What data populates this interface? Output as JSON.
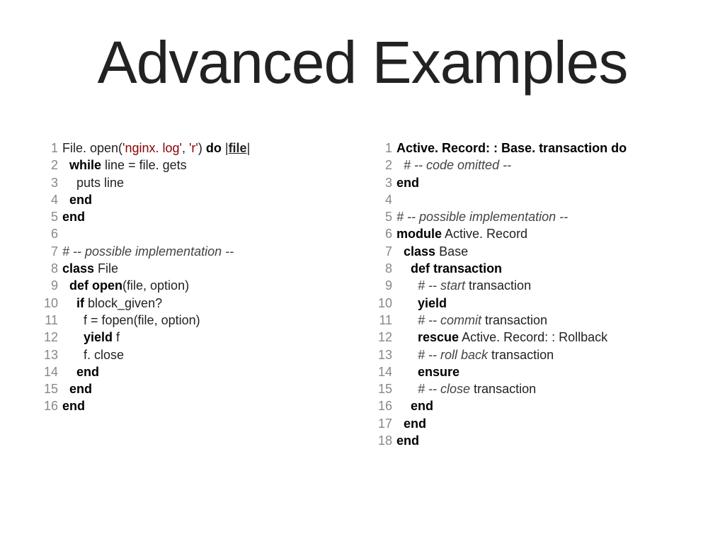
{
  "title": "Advanced Examples",
  "left": [
    {
      "n": "1",
      "segs": [
        {
          "t": "File. open("
        },
        {
          "t": "'nginx. log'",
          "c": "tok-str"
        },
        {
          "t": ", "
        },
        {
          "t": "'r'",
          "c": "tok-str"
        },
        {
          "t": ") "
        },
        {
          "t": "do",
          "c": "tok-kw"
        },
        {
          "t": " |"
        },
        {
          "t": "file",
          "c": "tok-br"
        },
        {
          "t": "|"
        }
      ]
    },
    {
      "n": "2",
      "segs": [
        {
          "t": "  "
        },
        {
          "t": "while",
          "c": "tok-kw"
        },
        {
          "t": " line = file. gets"
        }
      ]
    },
    {
      "n": "3",
      "segs": [
        {
          "t": "    puts line"
        }
      ]
    },
    {
      "n": "4",
      "segs": [
        {
          "t": "  "
        },
        {
          "t": "end",
          "c": "tok-kw"
        }
      ]
    },
    {
      "n": "5",
      "segs": [
        {
          "t": "end",
          "c": "tok-kw"
        }
      ]
    },
    {
      "n": "6",
      "segs": [
        {
          "t": ""
        }
      ]
    },
    {
      "n": "7",
      "segs": [
        {
          "t": "# -- possible implementation --",
          "c": "tok-com"
        }
      ]
    },
    {
      "n": "8",
      "segs": [
        {
          "t": "class",
          "c": "tok-kw"
        },
        {
          "t": " File"
        }
      ]
    },
    {
      "n": "9",
      "segs": [
        {
          "t": "  "
        },
        {
          "t": "def",
          "c": "tok-kw"
        },
        {
          "t": " "
        },
        {
          "t": "open",
          "c": "tok-kw"
        },
        {
          "t": "(file, option)"
        }
      ]
    },
    {
      "n": "10",
      "segs": [
        {
          "t": "    "
        },
        {
          "t": "if",
          "c": "tok-kw"
        },
        {
          "t": " block_given?"
        }
      ]
    },
    {
      "n": "11",
      "segs": [
        {
          "t": "      f = fopen(file, option)"
        }
      ]
    },
    {
      "n": "12",
      "segs": [
        {
          "t": "      "
        },
        {
          "t": "yield",
          "c": "tok-kw"
        },
        {
          "t": " f"
        }
      ]
    },
    {
      "n": "13",
      "segs": [
        {
          "t": "      f. close"
        }
      ]
    },
    {
      "n": "14",
      "segs": [
        {
          "t": "    "
        },
        {
          "t": "end",
          "c": "tok-kw"
        }
      ]
    },
    {
      "n": "15",
      "segs": [
        {
          "t": "  "
        },
        {
          "t": "end",
          "c": "tok-kw"
        }
      ]
    },
    {
      "n": "16",
      "segs": [
        {
          "t": "end",
          "c": "tok-kw"
        }
      ]
    }
  ],
  "right": [
    {
      "n": "1",
      "segs": [
        {
          "t": "Active. Record: : Base. transaction",
          "c": "tok-kw"
        },
        {
          "t": " "
        },
        {
          "t": "do",
          "c": "tok-kw"
        }
      ]
    },
    {
      "n": "2",
      "segs": [
        {
          "t": "  "
        },
        {
          "t": "# -- code omitted --",
          "c": "tok-com"
        }
      ]
    },
    {
      "n": "3",
      "segs": [
        {
          "t": "end",
          "c": "tok-kw"
        }
      ]
    },
    {
      "n": "4",
      "segs": [
        {
          "t": ""
        }
      ]
    },
    {
      "n": "5",
      "segs": [
        {
          "t": "# -- possible implementation --",
          "c": "tok-com"
        }
      ]
    },
    {
      "n": "6",
      "segs": [
        {
          "t": "module",
          "c": "tok-kw"
        },
        {
          "t": " Active. Record"
        }
      ]
    },
    {
      "n": "7",
      "segs": [
        {
          "t": "  "
        },
        {
          "t": "class",
          "c": "tok-kw"
        },
        {
          "t": " Base"
        }
      ]
    },
    {
      "n": "8",
      "segs": [
        {
          "t": "    "
        },
        {
          "t": "def",
          "c": "tok-kw"
        },
        {
          "t": " "
        },
        {
          "t": "transaction",
          "c": "tok-kw"
        }
      ]
    },
    {
      "n": "9",
      "segs": [
        {
          "t": "      "
        },
        {
          "t": "# -- start",
          "c": "tok-com"
        },
        {
          "t": " transaction"
        }
      ]
    },
    {
      "n": "10",
      "segs": [
        {
          "t": "      "
        },
        {
          "t": "yield",
          "c": "tok-kw"
        }
      ]
    },
    {
      "n": "11",
      "segs": [
        {
          "t": "      "
        },
        {
          "t": "# -- commit",
          "c": "tok-com"
        },
        {
          "t": " transaction"
        }
      ]
    },
    {
      "n": "12",
      "segs": [
        {
          "t": "      "
        },
        {
          "t": "rescue",
          "c": "tok-kw"
        },
        {
          "t": " Active. Record: : Rollback"
        }
      ]
    },
    {
      "n": "13",
      "segs": [
        {
          "t": "      "
        },
        {
          "t": "# -- roll back",
          "c": "tok-com"
        },
        {
          "t": " transaction"
        }
      ]
    },
    {
      "n": "14",
      "segs": [
        {
          "t": "      "
        },
        {
          "t": "ensure",
          "c": "tok-kw"
        }
      ]
    },
    {
      "n": "15",
      "segs": [
        {
          "t": "      "
        },
        {
          "t": "# -- close",
          "c": "tok-com"
        },
        {
          "t": " transaction"
        }
      ]
    },
    {
      "n": "16",
      "segs": [
        {
          "t": "    "
        },
        {
          "t": "end",
          "c": "tok-kw"
        }
      ]
    },
    {
      "n": "17",
      "segs": [
        {
          "t": "  "
        },
        {
          "t": "end",
          "c": "tok-kw"
        }
      ]
    },
    {
      "n": "18",
      "segs": [
        {
          "t": "end",
          "c": "tok-kw"
        }
      ]
    }
  ]
}
